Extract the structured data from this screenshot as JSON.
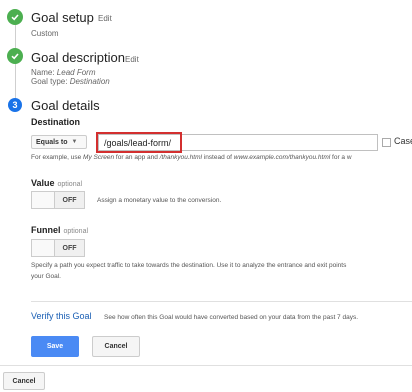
{
  "steps": {
    "setup": {
      "title": "Goal setup",
      "edit": "Edit",
      "value": "Custom"
    },
    "description": {
      "title": "Goal description",
      "edit": "Edit",
      "name_label": "Name:",
      "name_value": "Lead Form",
      "type_label": "Goal type:",
      "type_value": "Destination"
    },
    "details": {
      "number": "3",
      "title": "Goal details"
    }
  },
  "destination": {
    "label": "Destination",
    "match_type": "Equals to",
    "value": "/goals/lead-form/",
    "case_label": "Case",
    "help": {
      "p1": "For example, use ",
      "ex1": "My Screen",
      "p2": " for an app and ",
      "ex2": "/thankyou.html",
      "p3": " instead of ",
      "ex3": "www.example.com/thankyou.html",
      "p4": " for a w"
    }
  },
  "value_section": {
    "label": "Value",
    "optional": "optional",
    "toggle": "OFF",
    "hint": "Assign a monetary value to the conversion."
  },
  "funnel": {
    "label": "Funnel",
    "optional": "optional",
    "toggle": "OFF",
    "help_line1": "Specify a path you expect traffic to take towards the destination. Use it to analyze the entrance and exit points",
    "help_line2": "your Goal."
  },
  "verify": {
    "link": "Verify this Goal",
    "text": "See how often this Goal would have converted based on your data from the past 7 days."
  },
  "buttons": {
    "save": "Save",
    "cancel": "Cancel",
    "outer_cancel": "Cancel"
  },
  "colors": {
    "check": "#4caf50",
    "step_active": "#1a73e8",
    "primary": "#4a8af4",
    "highlight": "#d32f2f"
  }
}
